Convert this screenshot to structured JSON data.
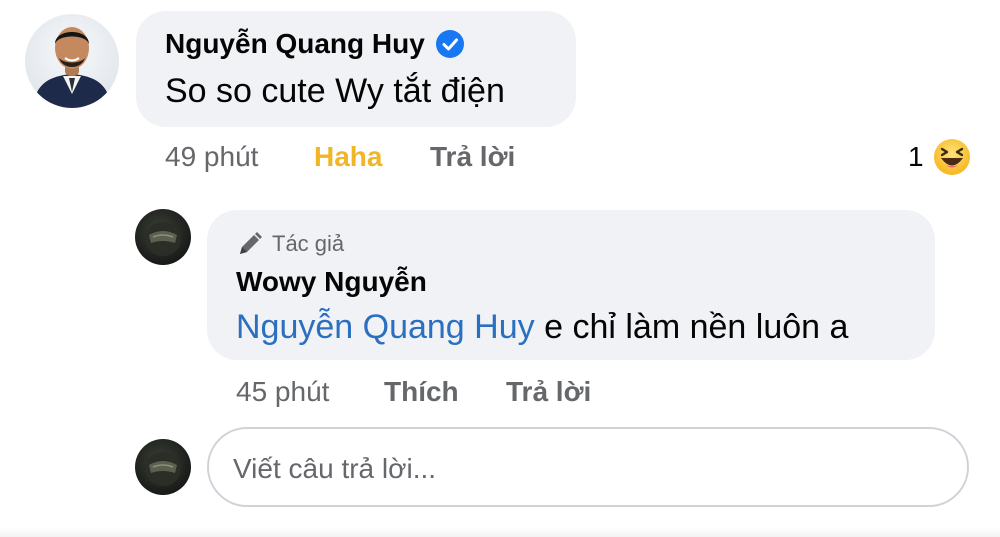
{
  "comment": {
    "author": "Nguyễn Quang Huy",
    "text": "So so cute Wy tắt điện",
    "time": "49 phút",
    "reaction_action": "Haha",
    "reply_action": "Trả lời",
    "reaction_count": "1",
    "reaction_icon": "laughing-emoji",
    "verified_icon": "verified-badge-icon"
  },
  "reply": {
    "badge": "Tác giả",
    "badge_icon": "pen-icon",
    "author": "Wowy Nguyễn",
    "mention": "Nguyễn Quang Huy",
    "text": "e chỉ làm nền luôn a",
    "time": "45 phút",
    "like_action": "Thích",
    "reply_action": "Trả lời"
  },
  "composer": {
    "placeholder": "Viết câu trả lời..."
  },
  "colors": {
    "bubble": "#f0f2f5",
    "mention": "#2b6fc0",
    "meta": "#65676b",
    "haha": "#f2b525",
    "verified": "#1877f2"
  }
}
